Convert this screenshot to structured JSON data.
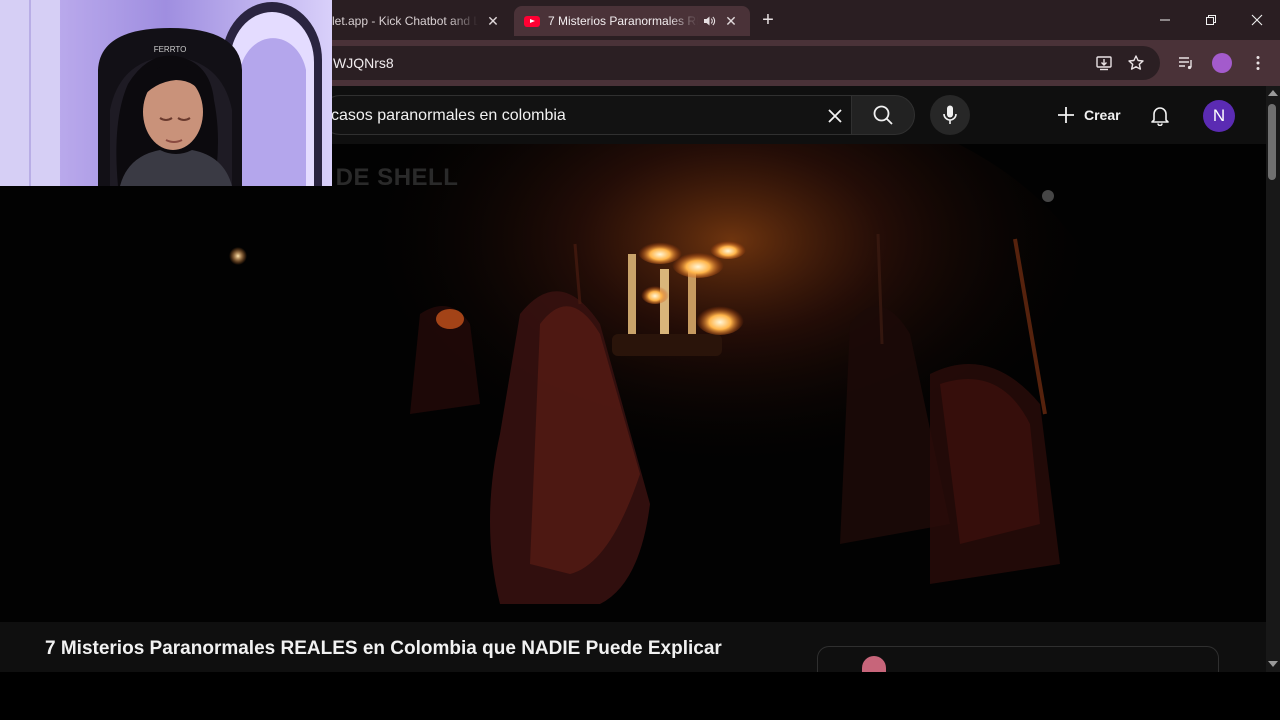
{
  "browser": {
    "tabs": [
      {
        "title": "let.app - Kick Chatbot and L",
        "active": false
      },
      {
        "title": "7 Misterios Paranormales REALES en Colombia que NADIE Puede Explicar",
        "active": true
      }
    ],
    "address_text": "WJQNrs8"
  },
  "youtube": {
    "search_query": "casos paranormales en colombia",
    "create_label": "Crear",
    "avatar_letter": "N",
    "video_overlay_text": "S DE SHELL",
    "video_title": "7 Misterios Paranormales REALES en Colombia que NADIE Puede Explicar"
  },
  "webcam": {
    "chair_text": "FERRTO"
  },
  "colors": {
    "tab_strip": "#2a1e22",
    "toolbar": "#4a3238",
    "youtube_red": "#ff0033",
    "avatar": "#5b2bb3"
  },
  "icons": [
    "youtube-favicon",
    "audio-icon",
    "close-icon",
    "plus-icon",
    "minimize-icon",
    "maximize-icon",
    "install-icon",
    "star-icon",
    "media-queue-icon",
    "profile-icon",
    "more-icon",
    "search-icon",
    "mic-icon",
    "bell-icon"
  ]
}
